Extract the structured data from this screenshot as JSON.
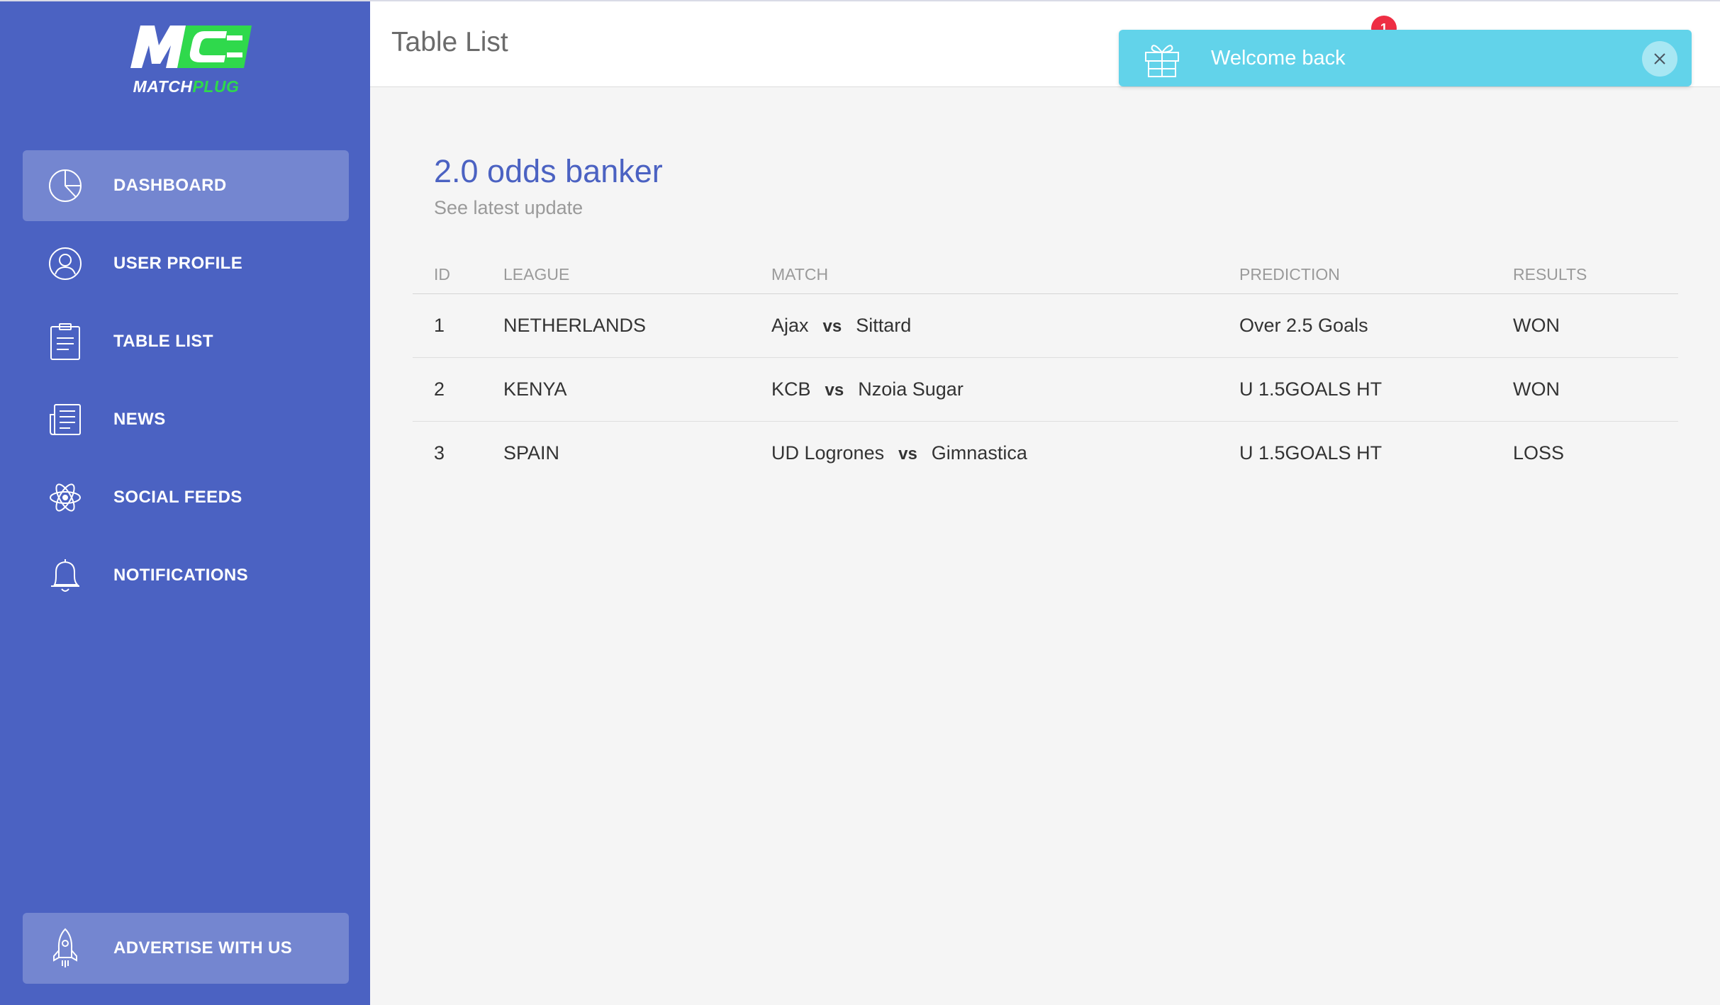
{
  "brand": {
    "name_part1": "MATCH",
    "name_part2": "PLUG",
    "logo_icon": "mc-plug-logo",
    "accent_green": "#2fd94c"
  },
  "sidebar": {
    "background": "#4b62c2",
    "items": [
      {
        "label": "DASHBOARD",
        "icon": "pie-chart-icon",
        "active": true
      },
      {
        "label": "USER PROFILE",
        "icon": "user-icon",
        "active": false
      },
      {
        "label": "TABLE LIST",
        "icon": "clipboard-icon",
        "active": false
      },
      {
        "label": "NEWS",
        "icon": "newspaper-icon",
        "active": false
      },
      {
        "label": "SOCIAL FEEDS",
        "icon": "atom-icon",
        "active": false
      },
      {
        "label": "NOTIFICATIONS",
        "icon": "bell-icon",
        "active": false
      }
    ],
    "footer_item": {
      "label": "ADVERTISE WITH US",
      "icon": "rocket-icon"
    }
  },
  "header": {
    "title": "Table List",
    "notification_count": "1"
  },
  "toast": {
    "message": "Welcome back",
    "icon": "gift-icon",
    "color": "#62d3ea"
  },
  "card": {
    "title": "2.0 odds banker",
    "subtitle": "See latest update",
    "title_color": "#4b62c2"
  },
  "table": {
    "columns": [
      "ID",
      "LEAGUE",
      "MATCH",
      "PREDICTION",
      "RESULTS"
    ],
    "vs_label": "vs",
    "rows": [
      {
        "id": "1",
        "league": "NETHERLANDS",
        "home": "Ajax",
        "away": "Sittard",
        "prediction": "Over 2.5 Goals",
        "result": "WON"
      },
      {
        "id": "2",
        "league": "KENYA",
        "home": "KCB",
        "away": "Nzoia Sugar",
        "prediction": "U 1.5GOALS HT",
        "result": "WON"
      },
      {
        "id": "3",
        "league": "SPAIN",
        "home": "UD Logrones",
        "away": "Gimnastica",
        "prediction": "U 1.5GOALS HT",
        "result": "LOSS"
      }
    ]
  }
}
